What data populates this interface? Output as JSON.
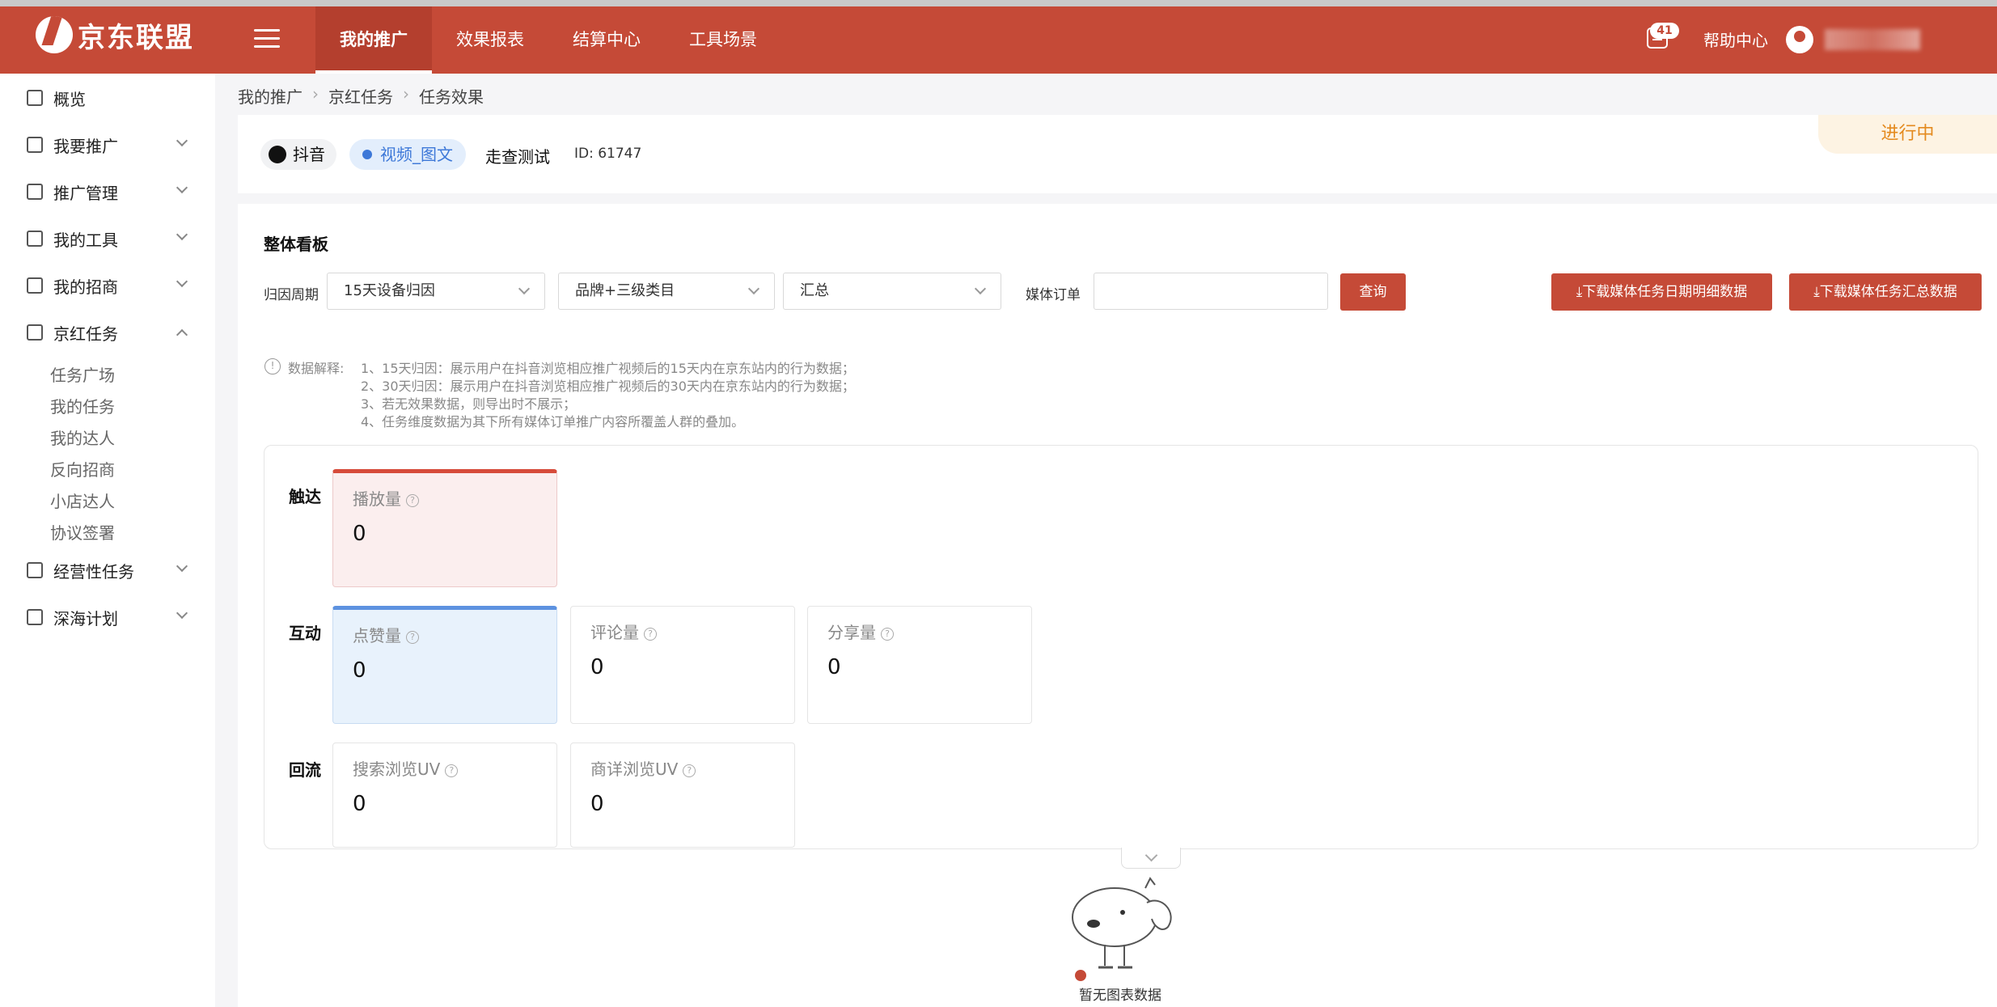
{
  "header": {
    "logo_text": "京东联盟",
    "tabs": [
      "我的推广",
      "效果报表",
      "结算中心",
      "工具场景"
    ],
    "active_tab": "我的推广",
    "notification_count": "41",
    "help_label": "帮助中心"
  },
  "sidebar": {
    "items": [
      {
        "label": "概览",
        "icon": "dashboard-icon"
      },
      {
        "label": "我要推广",
        "icon": "send-icon"
      },
      {
        "label": "推广管理",
        "icon": "manage-icon"
      },
      {
        "label": "我的工具",
        "icon": "tools-icon"
      },
      {
        "label": "我的招商",
        "icon": "merchant-icon"
      },
      {
        "label": "京红任务",
        "icon": "task-icon"
      },
      {
        "label": "经营性任务",
        "icon": "business-task-icon"
      },
      {
        "label": "深海计划",
        "icon": "deep-sea-icon"
      }
    ],
    "subitems": [
      "任务广场",
      "我的任务",
      "我的达人",
      "反向招商",
      "小店达人",
      "协议签署"
    ]
  },
  "breadcrumb": [
    "我的推广",
    "京红任务",
    "任务效果"
  ],
  "task": {
    "platform": "抖音",
    "content_type": "视频_图文",
    "name": "走查测试",
    "id": "ID: 61747",
    "status": "进行中"
  },
  "board": {
    "title": "整体看板",
    "filters": {
      "period_label": "归因周期",
      "period_value": "15天设备归因",
      "category_value": "品牌+三级类目",
      "summary_value": "汇总",
      "order_label": "媒体订单",
      "order_value": "",
      "query_button": "查询",
      "download_daily": "⤓下载媒体任务日期明细数据",
      "download_summary": "⤓下载媒体任务汇总数据"
    },
    "note_label": "数据解释:",
    "notes": [
      "1、15天归因：展示用户在抖音浏览相应推广视频后的15天内在京东站内的行为数据；",
      "2、30天归因：展示用户在抖音浏览相应推广视频后的30天内在京东站内的行为数据；",
      "3、若无效果数据，则导出时不展示；",
      "4、任务维度数据为其下所有媒体订单推广内容所覆盖人群的叠加。"
    ],
    "rows": [
      {
        "label": "触达",
        "cards": [
          {
            "title": "播放量",
            "value": "0"
          }
        ]
      },
      {
        "label": "互动",
        "cards": [
          {
            "title": "点赞量",
            "value": "0"
          },
          {
            "title": "评论量",
            "value": "0"
          },
          {
            "title": "分享量",
            "value": "0"
          }
        ]
      },
      {
        "label": "回流",
        "cards": [
          {
            "title": "搜索浏览UV",
            "value": "0"
          },
          {
            "title": "商详浏览UV",
            "value": "0"
          }
        ]
      }
    ],
    "empty_chart_text": "暂无图表数据"
  },
  "colors": {
    "brand_red": "#c54a37",
    "status_orange": "#e48a1e",
    "accent_blue": "#3d78d8"
  }
}
